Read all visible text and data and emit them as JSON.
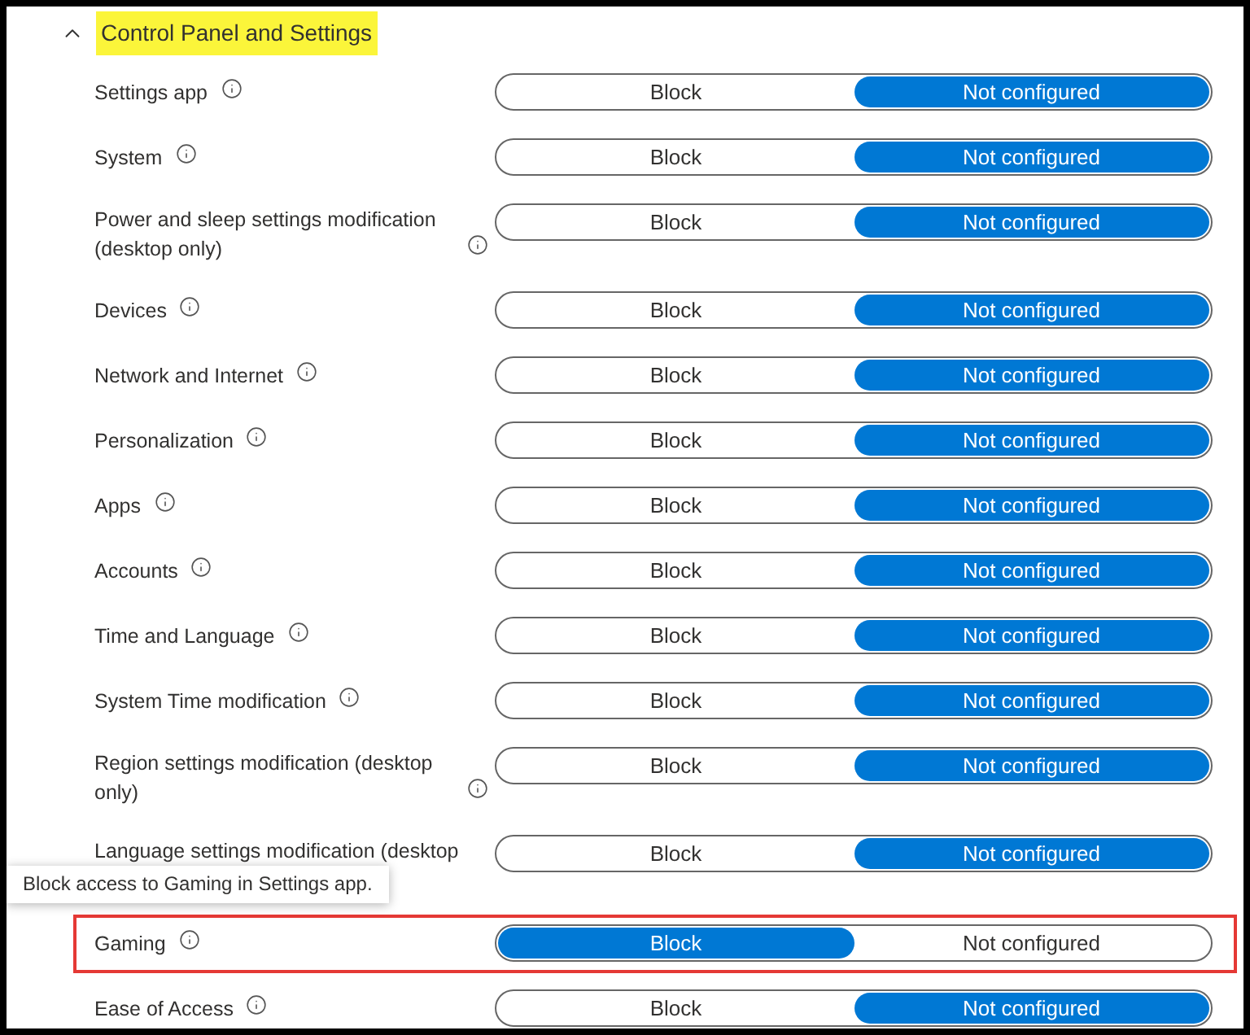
{
  "section": {
    "title": "Control Panel and Settings",
    "expanded": true,
    "highlighted": true
  },
  "settings": [
    {
      "label": "Settings app",
      "highlighted": false,
      "obscured": false,
      "options": [
        {
          "label": "Block",
          "selected": false
        },
        {
          "label": "Not configured",
          "selected": true
        }
      ]
    },
    {
      "label": "System",
      "highlighted": false,
      "obscured": false,
      "options": [
        {
          "label": "Block",
          "selected": false
        },
        {
          "label": "Not configured",
          "selected": true
        }
      ]
    },
    {
      "label": "Power and sleep settings modification (desktop only)",
      "highlighted": false,
      "obscured": false,
      "options": [
        {
          "label": "Block",
          "selected": false
        },
        {
          "label": "Not configured",
          "selected": true
        }
      ]
    },
    {
      "label": "Devices",
      "highlighted": false,
      "obscured": false,
      "options": [
        {
          "label": "Block",
          "selected": false
        },
        {
          "label": "Not configured",
          "selected": true
        }
      ]
    },
    {
      "label": "Network and Internet",
      "highlighted": false,
      "obscured": false,
      "options": [
        {
          "label": "Block",
          "selected": false
        },
        {
          "label": "Not configured",
          "selected": true
        }
      ]
    },
    {
      "label": "Personalization",
      "highlighted": false,
      "obscured": false,
      "options": [
        {
          "label": "Block",
          "selected": false
        },
        {
          "label": "Not configured",
          "selected": true
        }
      ]
    },
    {
      "label": "Apps",
      "highlighted": false,
      "obscured": false,
      "options": [
        {
          "label": "Block",
          "selected": false
        },
        {
          "label": "Not configured",
          "selected": true
        }
      ]
    },
    {
      "label": "Accounts",
      "highlighted": false,
      "obscured": false,
      "options": [
        {
          "label": "Block",
          "selected": false
        },
        {
          "label": "Not configured",
          "selected": true
        }
      ]
    },
    {
      "label": "Time and Language",
      "highlighted": false,
      "obscured": false,
      "options": [
        {
          "label": "Block",
          "selected": false
        },
        {
          "label": "Not configured",
          "selected": true
        }
      ]
    },
    {
      "label": "System Time modification",
      "highlighted": false,
      "obscured": false,
      "options": [
        {
          "label": "Block",
          "selected": false
        },
        {
          "label": "Not configured",
          "selected": true
        }
      ]
    },
    {
      "label": "Region settings modification (desktop only)",
      "highlighted": false,
      "obscured": false,
      "options": [
        {
          "label": "Block",
          "selected": false
        },
        {
          "label": "Not configured",
          "selected": true
        }
      ]
    },
    {
      "label": "Language settings modification (desktop",
      "highlighted": false,
      "obscured": true,
      "options": [
        {
          "label": "Block",
          "selected": false
        },
        {
          "label": "Not configured",
          "selected": true
        }
      ]
    },
    {
      "label": "Gaming",
      "highlighted": true,
      "obscured": false,
      "tooltip": "Block access to Gaming in Settings app.",
      "options": [
        {
          "label": "Block",
          "selected": true
        },
        {
          "label": "Not configured",
          "selected": false
        }
      ]
    },
    {
      "label": "Ease of Access",
      "highlighted": false,
      "obscured": false,
      "options": [
        {
          "label": "Block",
          "selected": false
        },
        {
          "label": "Not configured",
          "selected": true
        }
      ]
    }
  ]
}
